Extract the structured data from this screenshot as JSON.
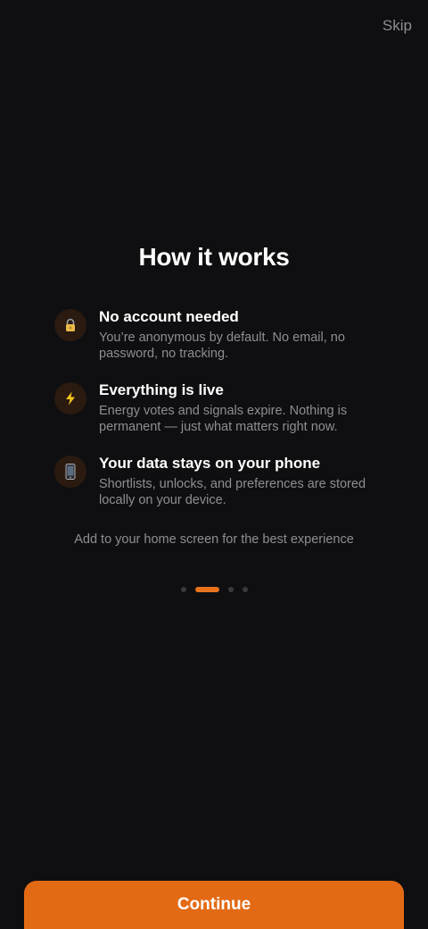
{
  "header": {
    "skip_label": "Skip"
  },
  "title": "How it works",
  "features": [
    {
      "icon": "lock-icon",
      "title": "No account needed",
      "description": "You’re anonymous by default. No email, no password, no tracking."
    },
    {
      "icon": "lightning-icon",
      "title": "Everything is live",
      "description": "Energy votes and signals expire. Nothing is permanent — just what matters right now."
    },
    {
      "icon": "phone-icon",
      "title": "Your data stays on your phone",
      "description": "Shortlists, unlocks, and preferences are stored locally on your device."
    }
  ],
  "hint": "Add to your home screen for the best experience",
  "pager": {
    "total": 4,
    "current": 2
  },
  "continue_label": "Continue",
  "colors": {
    "background": "#0f0f11",
    "accent": "#e36a14",
    "muted_text": "#8e8e93",
    "icon_bg": "#2a1a10"
  }
}
